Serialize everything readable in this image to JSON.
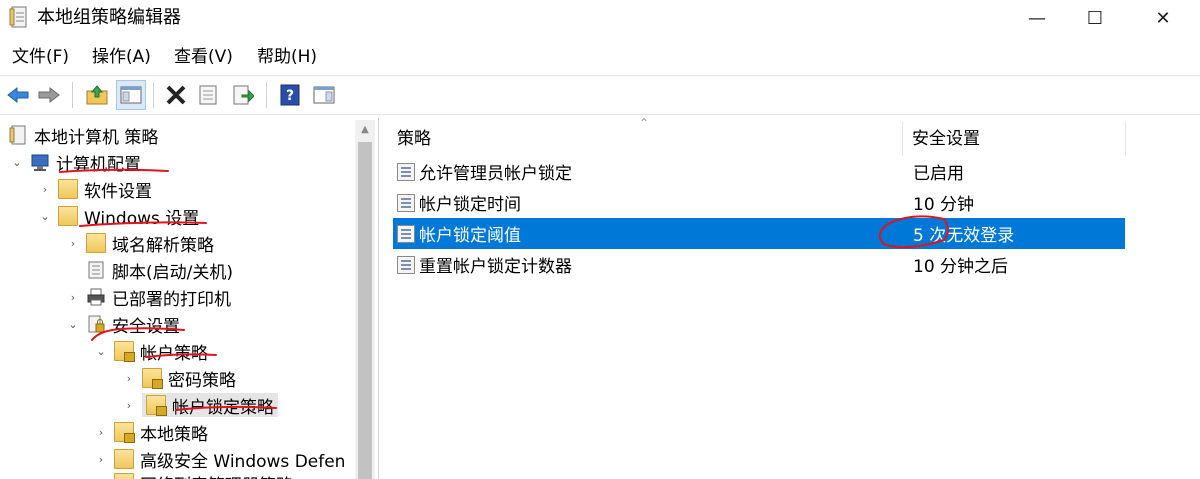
{
  "window": {
    "title": "本地组策略编辑器",
    "min_glyph": "—",
    "max_glyph": "☐",
    "close_glyph": "✕"
  },
  "menu": [
    {
      "label": "文件(F)"
    },
    {
      "label": "操作(A)"
    },
    {
      "label": "查看(V)"
    },
    {
      "label": "帮助(H)"
    }
  ],
  "toolbar": {
    "buttons": [
      "back-icon",
      "forward-icon",
      "up-folder-icon",
      "show-hide-tree-icon",
      "delete-icon",
      "properties-icon",
      "export-icon",
      "help-icon",
      "show-hide-action-pane-icon"
    ]
  },
  "tree": [
    {
      "label": "本地计算机 策略",
      "expander": ""
    },
    {
      "label": "计算机配置",
      "expander": "⌄"
    },
    {
      "label": "软件设置",
      "expander": "›"
    },
    {
      "label": "Windows 设置",
      "expander": "⌄"
    },
    {
      "label": "域名解析策略",
      "expander": "›"
    },
    {
      "label": "脚本(启动/关机)",
      "expander": ""
    },
    {
      "label": "已部署的打印机",
      "expander": "›"
    },
    {
      "label": "安全设置",
      "expander": "⌄"
    },
    {
      "label": "帐户策略",
      "expander": "⌄"
    },
    {
      "label": "密码策略",
      "expander": "›"
    },
    {
      "label": "帐户锁定策略",
      "expander": "›"
    },
    {
      "label": "本地策略",
      "expander": "›"
    },
    {
      "label": "高级安全 Windows Defen",
      "expander": "›"
    },
    {
      "label": "网络列表管理器策略",
      "expander": ""
    }
  ],
  "list": {
    "columns": [
      "策略",
      "安全设置"
    ],
    "rows": [
      {
        "policy": "允许管理员帐户锁定",
        "setting": "已启用"
      },
      {
        "policy": "帐户锁定时间",
        "setting": "10 分钟"
      },
      {
        "policy": "帐户锁定阈值",
        "setting": "5 次无效登录"
      },
      {
        "policy": "重置帐户锁定计数器",
        "setting": "10 分钟之后"
      }
    ],
    "selected_index": 2
  },
  "colors": {
    "selection": "#0078d7",
    "annotation": "#e0141e"
  }
}
